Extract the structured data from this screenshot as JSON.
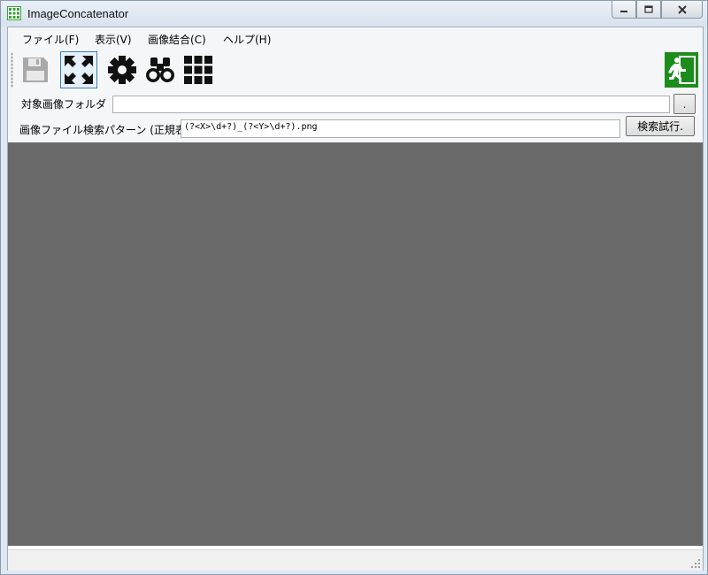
{
  "window": {
    "title": "ImageConcatenator"
  },
  "menu": {
    "items": [
      {
        "label": "ファイル(F)"
      },
      {
        "label": "表示(V)"
      },
      {
        "label": "画像結合(C)"
      },
      {
        "label": "ヘルプ(H)"
      }
    ]
  },
  "toolbar": {
    "buttons": [
      {
        "icon": "save-icon",
        "state": "disabled"
      },
      {
        "icon": "fit-expand-icon",
        "state": "active"
      },
      {
        "icon": "gear-icon",
        "state": "normal"
      },
      {
        "icon": "binoculars-icon",
        "state": "normal"
      },
      {
        "icon": "grid-icon",
        "state": "normal"
      },
      {
        "icon": "exit-icon",
        "state": "normal"
      }
    ]
  },
  "folder": {
    "label": "対象画像フォルダ",
    "value": "",
    "browse_label": "."
  },
  "pattern": {
    "label": "画像ファイル検索パターン (正規表",
    "value": "(?<X>\\d+?)_(?<Y>\\d+?).png",
    "test_label": "検索試行."
  },
  "colors": {
    "canvas": "#696969",
    "exit_accent": "#1c8c1c",
    "app_icon": "#3aa33a"
  }
}
